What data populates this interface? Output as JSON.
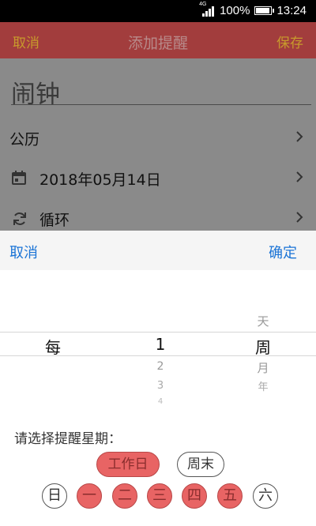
{
  "status_bar": {
    "network": "4G",
    "battery": "100%",
    "time": "13:24",
    "battery_level": 1.0
  },
  "app_bar": {
    "cancel_label": "取消",
    "title": "添加提醒",
    "save_label": "保存"
  },
  "form": {
    "name": "闹钟",
    "calendar_label": "公历",
    "date_value": "2018年05月14日",
    "repeat_label": "循环"
  },
  "picker": {
    "cancel_label": "取消",
    "confirm_label": "确定",
    "col1_selected": "每",
    "col2_selected": "1",
    "col2_below": [
      "2",
      "3",
      "4"
    ],
    "col3_above": "天",
    "col3_selected": "周",
    "col3_below": [
      "月",
      "年"
    ]
  },
  "weekday_section": {
    "prompt": "请选择提醒星期：",
    "presets": [
      {
        "label": "工作日",
        "selected": true
      },
      {
        "label": "周末",
        "selected": false
      }
    ],
    "days": [
      {
        "label": "日",
        "selected": false
      },
      {
        "label": "一",
        "selected": true
      },
      {
        "label": "二",
        "selected": true
      },
      {
        "label": "三",
        "selected": true
      },
      {
        "label": "四",
        "selected": true
      },
      {
        "label": "五",
        "selected": true
      },
      {
        "label": "六",
        "selected": false
      }
    ]
  },
  "colors": {
    "accent": "#e86464",
    "app_bar": "#a23d3d",
    "link": "#1b74d6",
    "overlay": "#8a8a8a"
  }
}
